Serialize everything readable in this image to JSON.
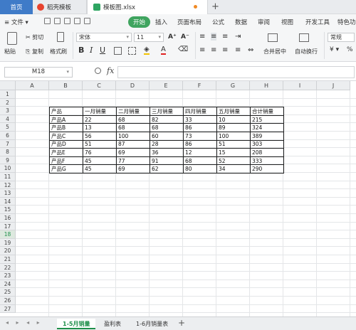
{
  "tabs": {
    "home": "首页",
    "template": "稻壳模板",
    "file": "模板图.xlsx",
    "add": "+"
  },
  "menu": {
    "file": "≡ 文件 ▾",
    "start": "开始",
    "items": [
      "插入",
      "页面布局",
      "公式",
      "数据",
      "审阅",
      "视图",
      "开发工具",
      "特色功"
    ]
  },
  "ribbon": {
    "cut": "剪切",
    "paste": "粘贴",
    "copy": "复制",
    "format_painter": "格式刷",
    "font_name": "宋体",
    "font_size": "11",
    "merge_center": "合并居中",
    "wrap_text": "自动换行",
    "number_format": "常规",
    "currency": "¥",
    "percent": "%"
  },
  "formula_bar": {
    "cell_ref": "M18",
    "fx": "fx",
    "content": ""
  },
  "grid": {
    "columns": [
      "A",
      "B",
      "C",
      "D",
      "E",
      "F",
      "G",
      "H",
      "I",
      "J"
    ],
    "rows": [
      "1",
      "2",
      "3",
      "4",
      "5",
      "6",
      "7",
      "8",
      "9",
      "10",
      "11",
      "12",
      "13",
      "14",
      "15",
      "16",
      "17",
      "18",
      "19",
      "20",
      "21",
      "22",
      "23",
      "24",
      "25",
      "26",
      "27"
    ],
    "selected_row": "18"
  },
  "table": {
    "header": [
      "产品",
      "一月销量",
      "二月销量",
      "三月销量",
      "四月销量",
      "五月销量",
      "合计销量"
    ],
    "rows": [
      [
        "产品A",
        "22",
        "68",
        "82",
        "33",
        "10",
        "215"
      ],
      [
        "产品B",
        "13",
        "68",
        "68",
        "86",
        "89",
        "324"
      ],
      [
        "产品C",
        "56",
        "100",
        "60",
        "73",
        "100",
        "389"
      ],
      [
        "产品D",
        "51",
        "87",
        "28",
        "86",
        "51",
        "303"
      ],
      [
        "产品E",
        "76",
        "69",
        "36",
        "12",
        "15",
        "208"
      ],
      [
        "产品F",
        "45",
        "77",
        "91",
        "68",
        "52",
        "333"
      ],
      [
        "产品G",
        "45",
        "69",
        "62",
        "80",
        "34",
        "290"
      ]
    ]
  },
  "sheets": {
    "tabs": [
      "1-5月销量",
      "盈利表",
      "1-6月销量表"
    ],
    "active": "1-5月销量",
    "add": "+"
  },
  "colors": {
    "accent_green": "#1e8f4a",
    "start_button": "#3fa45f",
    "home_tab": "#3f7bc8"
  }
}
